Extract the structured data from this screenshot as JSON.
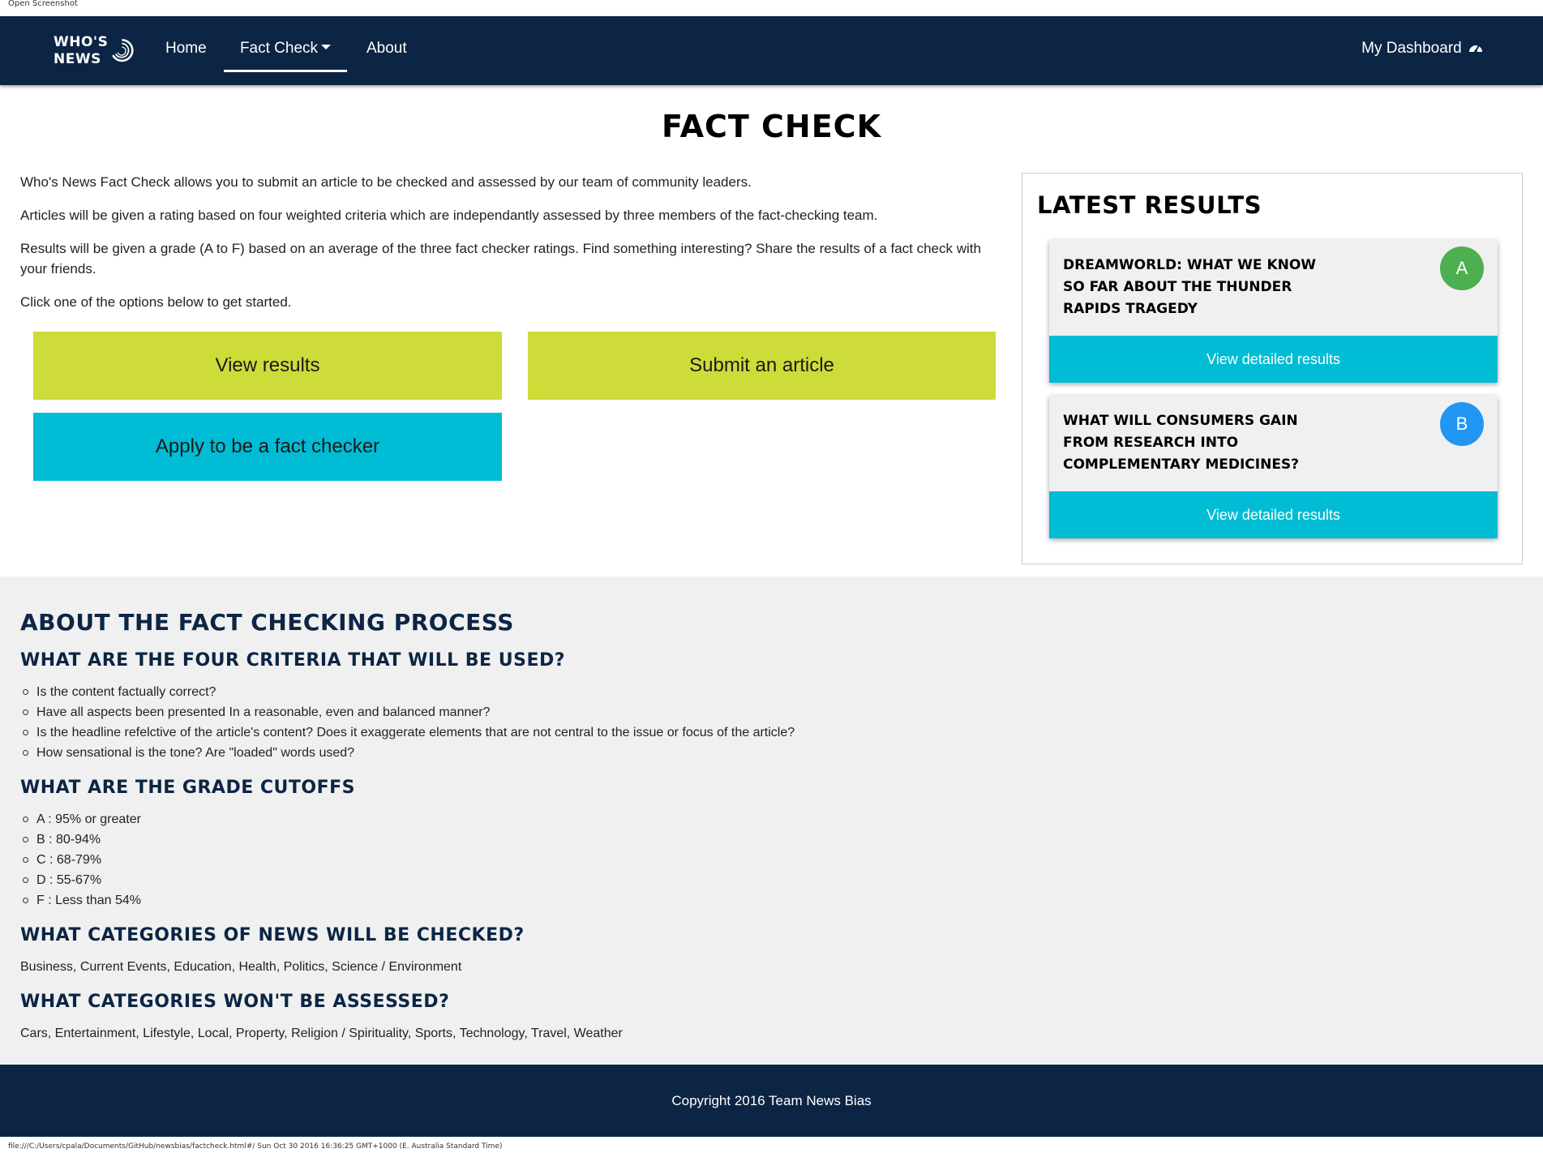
{
  "window": {
    "caption": "Open Screenshot"
  },
  "nav": {
    "logo_line1": "WHO'S",
    "logo_line2": "NEWS",
    "home": "Home",
    "fact_check": "Fact Check",
    "about": "About",
    "dashboard": "My Dashboard"
  },
  "main": {
    "title": "FACT CHECK",
    "intro": [
      "Who's News Fact Check allows you to submit an article to be checked and assessed by our team of community leaders.",
      "Articles will be given a rating based on four weighted criteria which are independantly assessed by three members of the fact-checking team.",
      "Results will be given a grade (A to F) based on an average of the three fact checker ratings. Find something interesting? Share the results of a fact check with your friends.",
      "Click one of the options below to get started."
    ],
    "buttons": {
      "view_results": "View results",
      "submit_article": "Submit an article",
      "apply": "Apply to be a fact checker"
    }
  },
  "latest": {
    "title": "LATEST RESULTS",
    "cards": [
      {
        "title": "Dreamworld: What we know so far about the Thunder Rapids tragedy",
        "grade": "A",
        "button": "View detailed results"
      },
      {
        "title": "What will consumers gain from research into complementary medicines?",
        "grade": "B",
        "button": "View detailed results"
      }
    ]
  },
  "about": {
    "heading": "ABOUT THE FACT CHECKING PROCESS",
    "criteria_heading": "WHAT ARE THE FOUR CRITERIA THAT WILL BE USED?",
    "criteria": [
      "Is the content factually correct?",
      "Have all aspects been presented In a reasonable, even and balanced manner?",
      "Is the headline refelctive of the article's content? Does it exaggerate elements that are not central to the issue or focus of the article?",
      "How sensational is the tone? Are \"loaded\" words used?"
    ],
    "grades_heading": "WHAT ARE THE GRADE CUTOFFS",
    "grades": [
      "A : 95% or greater",
      "B : 80-94%",
      "C : 68-79%",
      "D : 55-67%",
      "F : Less than 54%"
    ],
    "checked_heading": "WHAT CATEGORIES OF NEWS WILL BE CHECKED?",
    "checked": "Business, Current Events, Education, Health, Politics, Science / Environment",
    "excluded_heading": "WHAT CATEGORIES WON'T BE ASSESSED?",
    "excluded": "Cars, Entertainment, Lifestyle, Local, Property, Religion / Spirituality, Sports, Technology, Travel, Weather"
  },
  "footer": {
    "copyright": "Copyright 2016 Team News Bias"
  },
  "status_bar": {
    "text": "file:///C:/Users/cpala/Documents/GitHub/newsbias/factcheck.html#/ Sun Oct 30 2016 16:36:25 GMT+1000 (E. Australia Standard Time)"
  },
  "colors": {
    "navy": "#0c2544",
    "lime": "#cddc39",
    "cyan": "#00bcd4",
    "grade_a": "#4caf50",
    "grade_b": "#2196f3"
  },
  "icons": {
    "dashboard": "dashboard-gauge-icon",
    "caret": "caret-down-icon",
    "logo_mark": "swirl-logo-icon"
  }
}
